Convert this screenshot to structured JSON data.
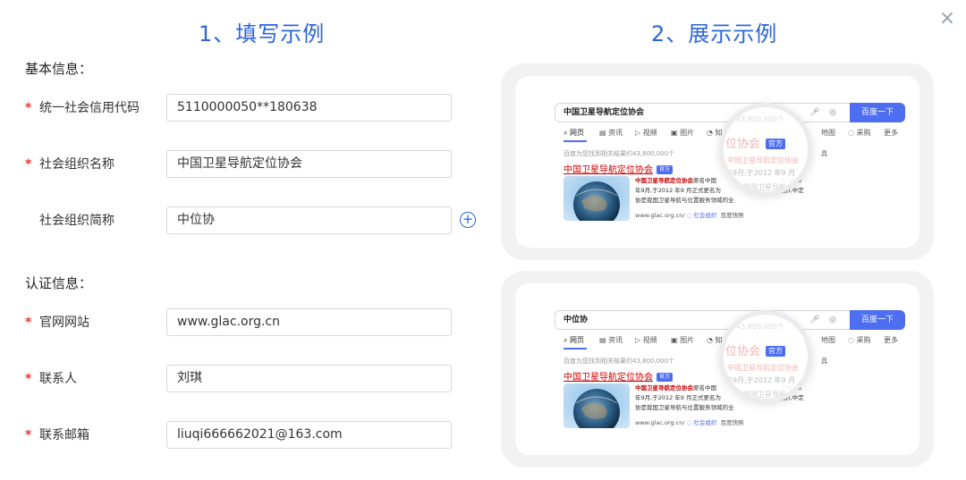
{
  "titles": {
    "fill": "1、填写示例",
    "display": "2、展示示例"
  },
  "close_label": "×",
  "sections": {
    "basic": "基本信息：",
    "auth": "认证信息："
  },
  "required_mark": "*",
  "add_symbol": "+",
  "fields": [
    {
      "label": "统一社会信用代码",
      "required": true,
      "value": "5110000050**180638"
    },
    {
      "label": "社会组织名称",
      "required": true,
      "value": "中国卫星导航定位协会"
    },
    {
      "label": "社会组织简称",
      "required": false,
      "value": "中位协"
    },
    {
      "label": "官网网站",
      "required": true,
      "value": "www.glac.org.cn"
    },
    {
      "label": "联系人",
      "required": true,
      "value": "刘琪"
    },
    {
      "label": "联系邮箱",
      "required": true,
      "value": "liuqi666662021@163.com"
    }
  ],
  "previews": [
    {
      "query": "中国卫星导航定位协会",
      "search_button": "百度一下",
      "tabs": [
        "网页",
        "资讯",
        "视频",
        "图片",
        "知",
        "地图",
        "采购",
        "更多"
      ],
      "result_count": "百度为您找到相关结果约43,800,000个",
      "result_title": "中国卫星导航定位协会",
      "badge": "官方",
      "snippet_hl": "中国卫星导航定位协会",
      "snippet_a": "原名中国",
      "snippet_b": "于1995",
      "snippet_c": "年9月,于2012 年9 月正式更名为",
      "snippet_d": "定协),中定",
      "snippet_e": "协是我国卫星导航与位置服务领域的全",
      "url": "www.glac.org.cn/",
      "url_tag": "社会组织",
      "url_snap": "百度快照",
      "mag_count": "43,800,000个",
      "mag_title": "位协会",
      "mag_sub": "中国卫星导航定位协会",
      "mag_line1": "年9月,于2012 年9 月",
      "mag_line2": "协是我国卫星导航",
      "mag_right": "具"
    },
    {
      "query": "中位协",
      "search_button": "百度一下",
      "tabs": [
        "网页",
        "资讯",
        "视频",
        "图片",
        "知",
        "地图",
        "采购",
        "更多"
      ],
      "result_count": "百度为您找到相关结果约43,800,000个",
      "result_title": "中国卫星导航定位协会",
      "badge": "官方",
      "snippet_hl": "中国卫星导航定位协会",
      "snippet_a": "原名中国",
      "snippet_b": "于1995",
      "snippet_c": "年9月,于2012 年9 月正式更名为",
      "snippet_d": "定协),中定",
      "snippet_e": "协是我国卫星导航与位置服务领域的全",
      "url": "www.glac.org.cn/",
      "url_tag": "社会组织",
      "url_snap": "百度快照",
      "mag_count": "43,800,000个",
      "mag_title": "位协会",
      "mag_sub": "中国卫星导航定位协会",
      "mag_line1": "年9月,于2012 年9 月",
      "mag_line2": "协是我国卫星导航",
      "mag_right": "具"
    }
  ],
  "colors": {
    "accent": "#2b66d9",
    "required": "#e33b2e",
    "baidu_blue": "#4e6ef2",
    "result_red": "#cc0000"
  }
}
